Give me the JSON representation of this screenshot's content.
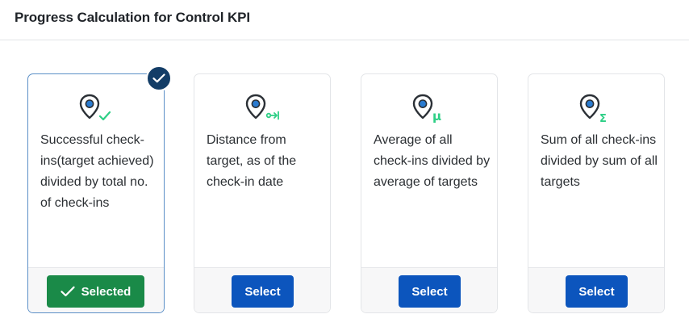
{
  "header": {
    "title": "Progress Calculation for Control KPI"
  },
  "colors": {
    "selected_green": "#1a8a48",
    "select_blue": "#0c55bd",
    "badge_navy": "#133d67",
    "icon_accent": "#2ecf86",
    "pin_fill": "#2a7bd0"
  },
  "cards": [
    {
      "icon": "location-pin-check-icon",
      "description": "Successful check-ins(target achieved) divided by total no. of check-ins",
      "button_label": "Selected",
      "selected": true
    },
    {
      "icon": "location-pin-distance-icon",
      "description": "Distance from target, as of the check-in date",
      "button_label": "Select",
      "selected": false
    },
    {
      "icon": "location-pin-mu-icon",
      "glyph": "μ",
      "description": "Average of all check-ins divided by average of targets",
      "button_label": "Select",
      "selected": false
    },
    {
      "icon": "location-pin-sigma-icon",
      "glyph": "Σ",
      "description": "Sum of all check-ins divided by sum of all targets",
      "button_label": "Select",
      "selected": false
    }
  ]
}
